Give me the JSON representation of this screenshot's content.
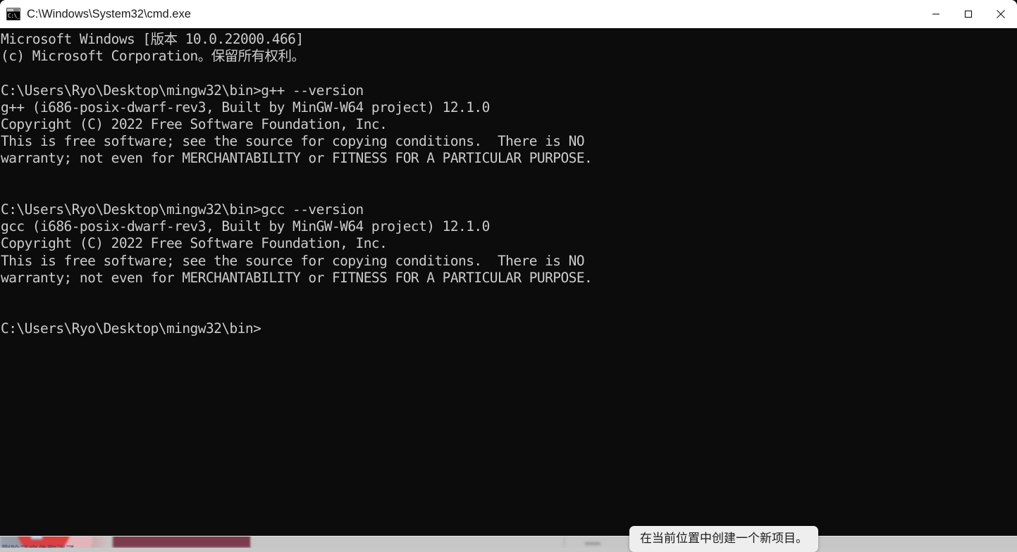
{
  "window": {
    "title": "C:\\Windows\\System32\\cmd.exe",
    "icon": "cmd-console-icon",
    "icon_glyph": "C:\\_",
    "titlebar_background": "#ffffff",
    "console_background": "#0c0c0c",
    "console_foreground": "#cccccc",
    "controls": {
      "minimize_label": "Minimize",
      "maximize_label": "Maximize",
      "close_label": "Close"
    }
  },
  "console": {
    "lines": [
      "Microsoft Windows [版本 10.0.22000.466]",
      "(c) Microsoft Corporation。保留所有权利。",
      "",
      "C:\\Users\\Ryo\\Desktop\\mingw32\\bin>g++ --version",
      "g++ (i686-posix-dwarf-rev3, Built by MinGW-W64 project) 12.1.0",
      "Copyright (C) 2022 Free Software Foundation, Inc.",
      "This is free software; see the source for copying conditions.  There is NO",
      "warranty; not even for MERCHANTABILITY or FITNESS FOR A PARTICULAR PURPOSE.",
      "",
      "",
      "C:\\Users\\Ryo\\Desktop\\mingw32\\bin>gcc --version",
      "gcc (i686-posix-dwarf-rev3, Built by MinGW-W64 project) 12.1.0",
      "Copyright (C) 2022 Free Software Foundation, Inc.",
      "This is free software; see the source for copying conditions.  There is NO",
      "warranty; not even for MERCHANTABILITY or FITNESS FOR A PARTICULAR PURPOSE.",
      "",
      "",
      "C:\\Users\\Ryo\\Desktop\\mingw32\\bin>"
    ],
    "text": "Microsoft Windows [版本 10.0.22000.466]\n(c) Microsoft Corporation。保留所有权利。\n\nC:\\Users\\Ryo\\Desktop\\mingw32\\bin>g++ --version\ng++ (i686-posix-dwarf-rev3, Built by MinGW-W64 project) 12.1.0\nCopyright (C) 2022 Free Software Foundation, Inc.\nThis is free software; see the source for copying conditions.  There is NO\nwarranty; not even for MERCHANTABILITY or FITNESS FOR A PARTICULAR PURPOSE.\n\n\nC:\\Users\\Ryo\\Desktop\\mingw32\\bin>gcc --version\ngcc (i686-posix-dwarf-rev3, Built by MinGW-W64 project) 12.1.0\nCopyright (C) 2022 Free Software Foundation, Inc.\nThis is free software; see the source for copying conditions.  There is NO\nwarranty; not even for MERCHANTABILITY or FITNESS FOR A PARTICULAR PURPOSE.\n\n\nC:\\Users\\Ryo\\Desktop\\mingw32\\bin>",
    "prompt": "C:\\Users\\Ryo\\Desktop\\mingw32\\bin>",
    "commands": [
      "g++ --version",
      "gcc --version"
    ],
    "compiler_version": "12.1.0",
    "compiler_build": "i686-posix-dwarf-rev3, Built by MinGW-W64 project",
    "copyright_year": "2022"
  },
  "tooltip": {
    "text": "在当前位置中创建一个新项目。",
    "background": "#eeeeee",
    "foreground": "#1c1c1c"
  },
  "desktop": {
    "background": "#cfcfcf",
    "obscured_text": "删除了文件取消了"
  }
}
